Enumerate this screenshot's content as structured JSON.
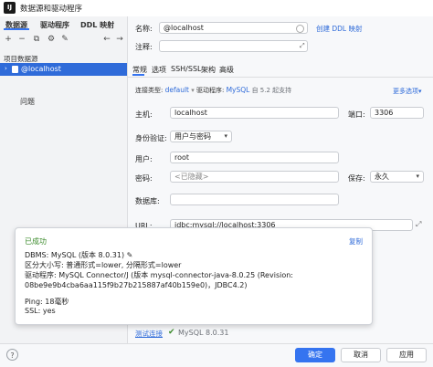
{
  "window": {
    "logo": "IJ",
    "title": "数据源和驱动程序"
  },
  "left": {
    "tabs": [
      "数据源",
      "驱动程序",
      "DDL 映射"
    ],
    "toolbar_icons": [
      "add-icon",
      "remove-icon",
      "copy-icon",
      "settings-icon",
      "edit-icon",
      "back-icon",
      "forward-icon"
    ],
    "toolbar_glyphs": [
      "+",
      "−",
      "⧉",
      "⚙",
      "✎",
      "←",
      "→"
    ],
    "section_title": "项目数据源",
    "datasource": "@localhost",
    "problems": "问题"
  },
  "form": {
    "name_label": "名称:",
    "name_value": "@localhost",
    "ddl_link": "创建 DDL 映射",
    "comment_label": "注释:",
    "tabs": [
      "常规",
      "选项",
      "SSH/SSL",
      "架构",
      "高级"
    ],
    "conn_type_label": "连接类型:",
    "conn_type_value": "default",
    "driver_label": "驱动程序:",
    "driver_value": "MySQL",
    "driver_note": "自 5.2 起支持",
    "more_options": "更多选项",
    "host_label": "主机:",
    "host_value": "localhost",
    "port_label": "端口:",
    "port_value": "3306",
    "auth_label": "身份验证:",
    "auth_value": "用户与密码",
    "user_label": "用户:",
    "user_value": "root",
    "password_label": "密码:",
    "password_placeholder": "<已隐藏>",
    "save_label": "保存:",
    "save_value": "永久",
    "database_label": "数据库:",
    "url_label": "URL:",
    "url_value": "jdbc:mysql://localhost:3306",
    "test_link": "测试连接",
    "test_result": "MySQL 8.0.31"
  },
  "popup": {
    "title": "已成功",
    "copy": "复制",
    "lines": [
      "DBMS: MySQL (版本 8.0.31)",
      "区分大小写: 普通形式=lower, 分隔形式=lower",
      "驱动程序: MySQL Connector/J (版本 mysql-connector-java-8.0.25 (Revision:",
      "08be9e9b4cba6aa115f9b27b215887af40b159e0)，JDBC4.2)",
      "",
      "Ping: 18毫秒",
      "SSL: yes"
    ]
  },
  "footer": {
    "help": "?",
    "ok": "确定",
    "cancel": "取消",
    "apply": "应用"
  },
  "colors": {
    "accent": "#3574f0",
    "selected": "#2f6bd9",
    "success": "#3a8a2a"
  }
}
